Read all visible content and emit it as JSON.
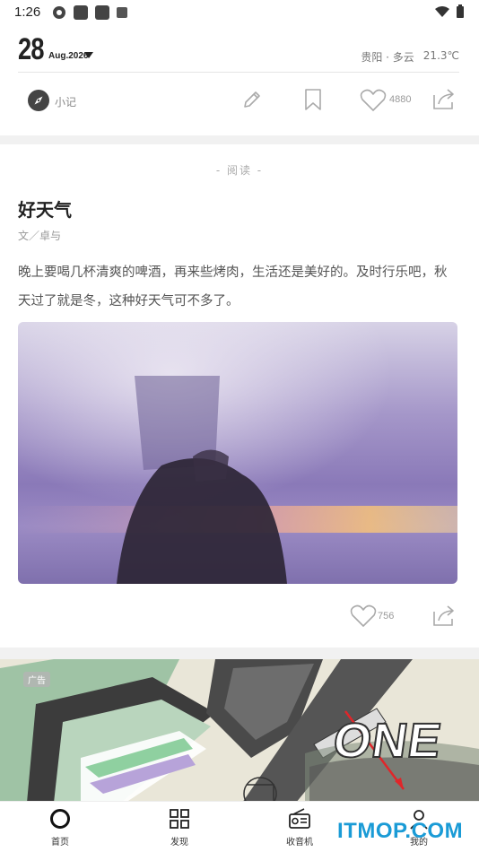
{
  "status_bar": {
    "time": "1:26"
  },
  "header": {
    "day": "28",
    "month_year": "Aug.2026",
    "location": "贵阳 · 多云",
    "temperature": "21.3℃"
  },
  "toolbar": {
    "section_label": "小记",
    "like_count": "4880"
  },
  "article": {
    "category": "- 阅读 -",
    "title": "好天气",
    "author": "文／卓与",
    "excerpt": "晚上要喝几杯清爽的啤酒，再来些烤肉，生活还是美好的。及时行乐吧，秋天过了就是冬，这种好天气可不多了。",
    "like_count": "756"
  },
  "ad": {
    "badge": "广告",
    "brand_text": "ONE"
  },
  "bottom_nav": {
    "items": [
      {
        "label": "首页",
        "icon": "home-circle-icon"
      },
      {
        "label": "发现",
        "icon": "grid-icon"
      },
      {
        "label": "收音机",
        "icon": "radio-icon"
      },
      {
        "label": "我的",
        "icon": "person-icon"
      }
    ]
  },
  "watermark": "ITMOP.COM",
  "colors": {
    "accent_watermark": "#1a9bd6",
    "ad_arrow": "#e0262a"
  }
}
